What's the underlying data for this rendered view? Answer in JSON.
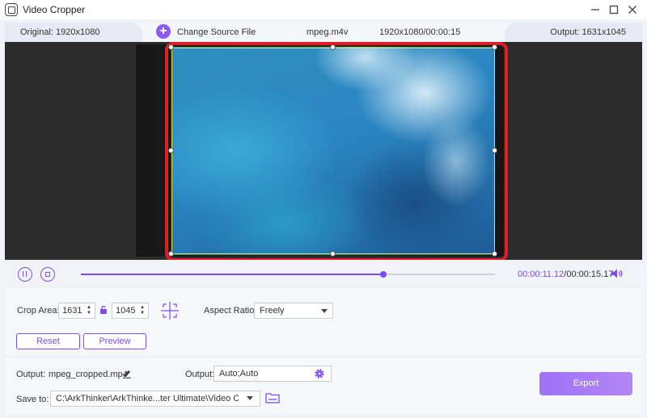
{
  "window": {
    "title": "Video Cropper"
  },
  "infobar": {
    "original": "Original: 1920x1080",
    "change_source": "Change Source File",
    "filename": "mpeg.m4v",
    "file_info": "1920x1080/00:00:15",
    "output": "Output: 1631x1045"
  },
  "playback": {
    "current_time": "00:00:11.12",
    "separator_total": "/00:00:15.17",
    "progress_fraction": 0.73
  },
  "crop": {
    "label": "Crop Area:",
    "width": "1631",
    "height": "1045",
    "aspect_label": "Aspect Ratio:",
    "aspect_value": "Freely",
    "reset_label": "Reset",
    "preview_label": "Preview"
  },
  "output": {
    "label": "Output:",
    "filename": "mpeg_cropped.mp4",
    "format_label": "Output:",
    "format_value": "Auto;Auto",
    "save_label": "Save to:",
    "save_path": "C:\\ArkThinker\\ArkThinke...ter Ultimate\\Video Crop",
    "export_label": "Export"
  },
  "colors": {
    "accent": "#7a4df0",
    "crop_border": "#e31b23",
    "crop_guide": "#d8e84a"
  }
}
